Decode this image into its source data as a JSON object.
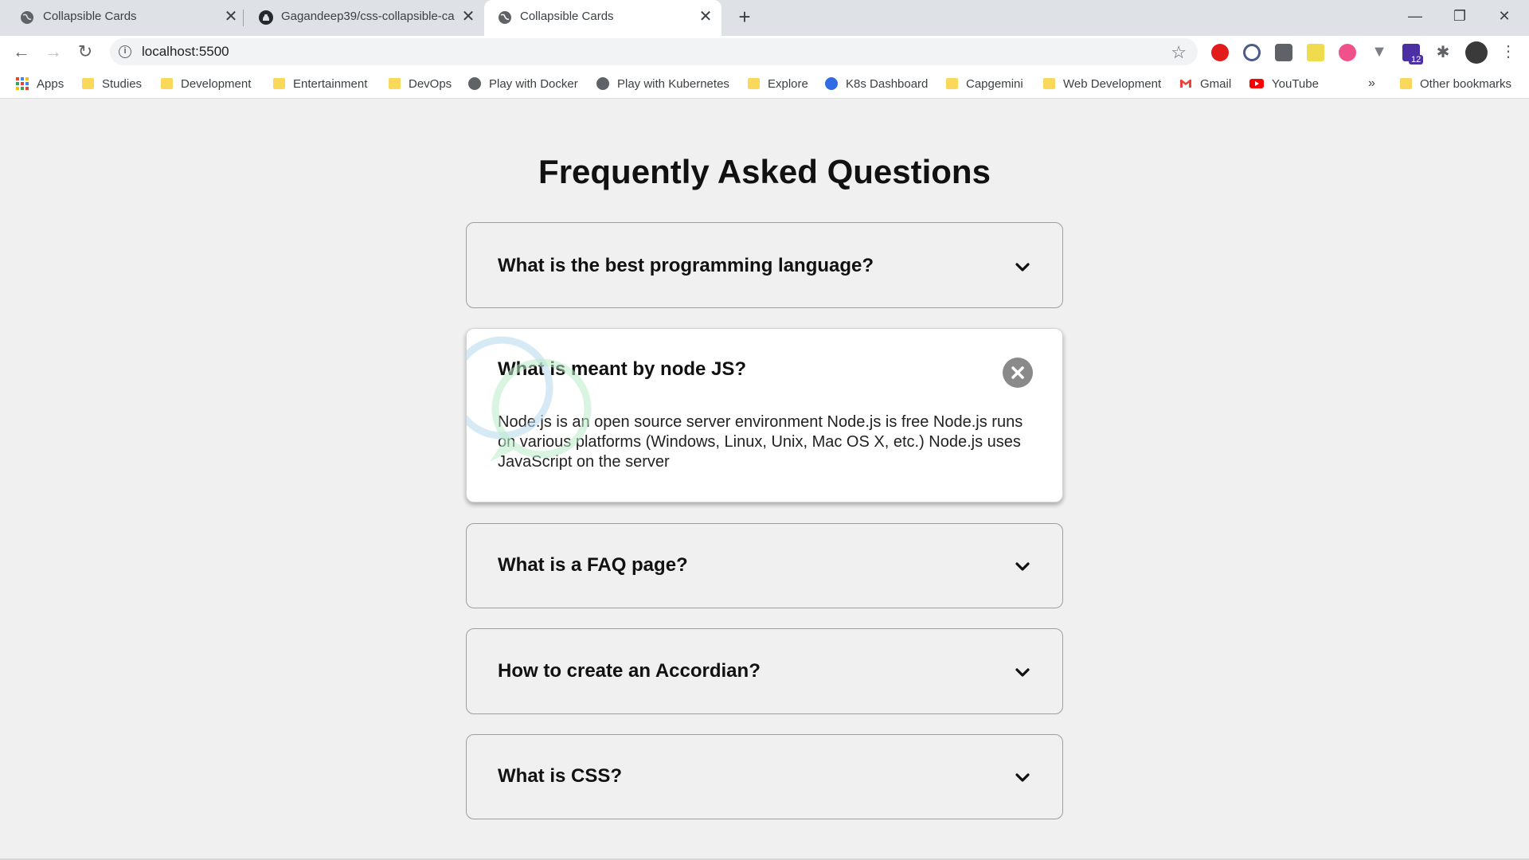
{
  "browser": {
    "tabs": [
      {
        "title": "Collapsible Cards",
        "icon": "globe-icon"
      },
      {
        "title": "Gagandeep39/css-collapsible-ca",
        "icon": "github-icon"
      },
      {
        "title": "Collapsible Cards",
        "icon": "globe-icon"
      }
    ],
    "url": "localhost:5500",
    "bookmarks": [
      {
        "label": "Apps",
        "icon": "apps-grid-icon"
      },
      {
        "label": "Studies",
        "icon": "folder-icon"
      },
      {
        "label": "Development",
        "icon": "folder-icon"
      },
      {
        "label": "Entertainment",
        "icon": "folder-icon"
      },
      {
        "label": "DevOps",
        "icon": "folder-icon"
      },
      {
        "label": "Play with Docker",
        "icon": "globe-icon"
      },
      {
        "label": "Play with Kubernetes",
        "icon": "globe-icon"
      },
      {
        "label": "Explore",
        "icon": "folder-icon"
      },
      {
        "label": "K8s Dashboard",
        "icon": "kubernetes-icon"
      },
      {
        "label": "Capgemini",
        "icon": "folder-icon"
      },
      {
        "label": "Web Development",
        "icon": "folder-icon"
      },
      {
        "label": "Gmail",
        "icon": "gmail-icon"
      },
      {
        "label": "YouTube",
        "icon": "youtube-icon"
      }
    ],
    "bookmarks_overflow": "»",
    "other_bookmarks": "Other bookmarks",
    "extension_badge": "12"
  },
  "page": {
    "title": "Frequently Asked Questions",
    "faqs": [
      {
        "question": "What is the best programming language?",
        "answer": "",
        "open": false
      },
      {
        "question": "What is meant by node JS?",
        "answer": "Node.js is an open source server environment Node.js is free Node.js runs on various platforms (Windows, Linux, Unix, Mac OS X, etc.) Node.js uses JavaScript on the server",
        "open": true
      },
      {
        "question": "What is a FAQ page?",
        "answer": "",
        "open": false
      },
      {
        "question": "How to create an Accordian?",
        "answer": "",
        "open": false
      },
      {
        "question": "What is CSS?",
        "answer": "",
        "open": false
      }
    ]
  },
  "colors": {
    "page_bg": "#f0f0f0",
    "card_border": "#9e9e9e",
    "active_card_bg": "#ffffff",
    "close_button": "#8a8a8a"
  }
}
